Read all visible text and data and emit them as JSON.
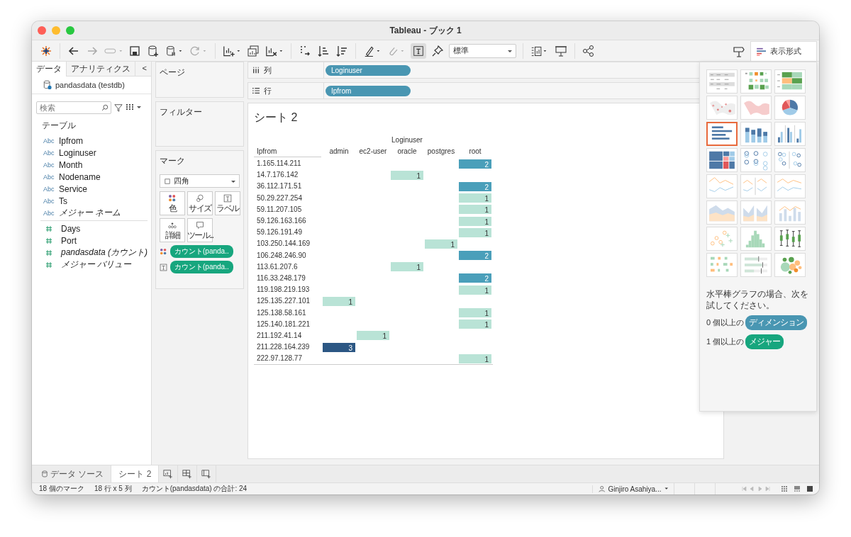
{
  "window": {
    "title": "Tableau - ブック 1"
  },
  "toolbar": {
    "label_toggle_on": true,
    "fit": "標準",
    "show_me_tab": "表示形式"
  },
  "data_pane": {
    "tabs": [
      {
        "label": "データ",
        "selected": true
      },
      {
        "label": "アナリティクス",
        "selected": false
      }
    ],
    "collapse": "<",
    "source": "pandasdata (testdb)",
    "search": {
      "placeholder": "検索"
    },
    "section": "テーブル",
    "fields": [
      {
        "kind": "dimension",
        "type_label": "Abc",
        "name": "Ipfrom",
        "italic": false
      },
      {
        "kind": "dimension",
        "type_label": "Abc",
        "name": "Loginuser",
        "italic": false
      },
      {
        "kind": "dimension",
        "type_label": "Abc",
        "name": "Month",
        "italic": false
      },
      {
        "kind": "dimension",
        "type_label": "Abc",
        "name": "Nodename",
        "italic": false
      },
      {
        "kind": "dimension",
        "type_label": "Abc",
        "name": "Service",
        "italic": false
      },
      {
        "kind": "dimension",
        "type_label": "Abc",
        "name": "Ts",
        "italic": false
      },
      {
        "kind": "dimension",
        "type_label": "Abc",
        "name": "メジャー ネーム",
        "italic": true
      },
      {
        "kind": "measure",
        "name": "Days",
        "italic": false
      },
      {
        "kind": "measure",
        "name": "Port",
        "italic": false
      },
      {
        "kind": "measure",
        "name": "pandasdata (カウント)",
        "italic": true
      },
      {
        "kind": "measure",
        "name": "メジャー バリュー",
        "italic": true
      }
    ]
  },
  "cards": {
    "pages": "ページ",
    "filters": "フィルター",
    "marks": {
      "title": "マーク",
      "mark_type": "四角",
      "buttons": [
        {
          "kind": "color",
          "label": "色"
        },
        {
          "kind": "size",
          "label": "サイズ"
        },
        {
          "kind": "label",
          "label": "ラベル"
        },
        {
          "kind": "detail",
          "label": "詳細"
        },
        {
          "kind": "tooltip",
          "label": "ツール..."
        }
      ],
      "pills": [
        {
          "kind": "color",
          "label": "カウント(panda.."
        },
        {
          "kind": "label",
          "label": "カウント(panda.."
        }
      ]
    }
  },
  "shelves": [
    {
      "kind": "columns",
      "label": "列",
      "pill": "Loginuser"
    },
    {
      "kind": "rows",
      "label": "行",
      "pill": "Ipfrom"
    }
  ],
  "sheet": {
    "title": "シート 2",
    "row_header": "Ipfrom",
    "column_group": "Loginuser",
    "columns": [
      "admin",
      "ec2-user",
      "oracle",
      "postgres",
      "root"
    ],
    "rows": [
      {
        "ip": "1.165.114.211",
        "cells": [
          null,
          null,
          null,
          null,
          {
            "value": "2",
            "color": "#4a9fba"
          }
        ]
      },
      {
        "ip": "14.7.176.142",
        "cells": [
          null,
          null,
          {
            "value": "1",
            "color": "#b9e3d6"
          },
          null,
          null
        ]
      },
      {
        "ip": "36.112.171.51",
        "cells": [
          null,
          null,
          null,
          null,
          {
            "value": "2",
            "color": "#4a9fba"
          }
        ]
      },
      {
        "ip": "50.29.227.254",
        "cells": [
          null,
          null,
          null,
          null,
          {
            "value": "1",
            "color": "#b9e3d6"
          }
        ]
      },
      {
        "ip": "59.11.207.105",
        "cells": [
          null,
          null,
          null,
          null,
          {
            "value": "1",
            "color": "#b9e3d6"
          }
        ]
      },
      {
        "ip": "59.126.163.166",
        "cells": [
          null,
          null,
          null,
          null,
          {
            "value": "1",
            "color": "#b9e3d6"
          }
        ]
      },
      {
        "ip": "59.126.191.49",
        "cells": [
          null,
          null,
          null,
          null,
          {
            "value": "1",
            "color": "#b9e3d6"
          }
        ]
      },
      {
        "ip": "103.250.144.169",
        "cells": [
          null,
          null,
          null,
          {
            "value": "1",
            "color": "#b9e3d6"
          },
          null
        ]
      },
      {
        "ip": "106.248.246.90",
        "cells": [
          null,
          null,
          null,
          null,
          {
            "value": "2",
            "color": "#4a9fba"
          }
        ]
      },
      {
        "ip": "113.61.207.6",
        "cells": [
          null,
          null,
          {
            "value": "1",
            "color": "#b9e3d6"
          },
          null,
          null
        ]
      },
      {
        "ip": "116.33.248.179",
        "cells": [
          null,
          null,
          null,
          null,
          {
            "value": "2",
            "color": "#4a9fba"
          }
        ]
      },
      {
        "ip": "119.198.219.193",
        "cells": [
          null,
          null,
          null,
          null,
          {
            "value": "1",
            "color": "#b9e3d6"
          }
        ]
      },
      {
        "ip": "125.135.227.101",
        "cells": [
          {
            "value": "1",
            "color": "#b9e3d6"
          },
          null,
          null,
          null,
          null
        ]
      },
      {
        "ip": "125.138.58.161",
        "cells": [
          null,
          null,
          null,
          null,
          {
            "value": "1",
            "color": "#b9e3d6"
          }
        ]
      },
      {
        "ip": "125.140.181.221",
        "cells": [
          null,
          null,
          null,
          null,
          {
            "value": "1",
            "color": "#b9e3d6"
          }
        ]
      },
      {
        "ip": "211.192.41.14",
        "cells": [
          null,
          {
            "value": "1",
            "color": "#b9e3d6"
          },
          null,
          null,
          null
        ]
      },
      {
        "ip": "211.228.164.239",
        "cells": [
          {
            "value": "3",
            "color": "#2c5784"
          },
          null,
          null,
          null,
          null
        ]
      },
      {
        "ip": "222.97.128.77",
        "cells": [
          null,
          null,
          null,
          null,
          {
            "value": "1",
            "color": "#b9e3d6"
          }
        ]
      }
    ]
  },
  "show_me": {
    "charts": [
      {
        "kind": "text-table",
        "selected": false
      },
      {
        "kind": "heat-map",
        "selected": false
      },
      {
        "kind": "highlight-table",
        "selected": false
      },
      {
        "kind": "symbol-map",
        "selected": false
      },
      {
        "kind": "filled-map",
        "selected": false
      },
      {
        "kind": "pie",
        "selected": false
      },
      {
        "kind": "horizontal-bars",
        "selected": true
      },
      {
        "kind": "stacked-bars",
        "selected": false
      },
      {
        "kind": "side-by-side-bars",
        "selected": false
      },
      {
        "kind": "treemap",
        "selected": false
      },
      {
        "kind": "circle-views",
        "selected": false
      },
      {
        "kind": "side-by-side-circles",
        "selected": false
      },
      {
        "kind": "lines",
        "selected": false
      },
      {
        "kind": "lines-panes",
        "selected": false
      },
      {
        "kind": "dual-lines",
        "selected": false
      },
      {
        "kind": "area",
        "selected": false
      },
      {
        "kind": "area-panes",
        "selected": false
      },
      {
        "kind": "dual-combination",
        "selected": false
      },
      {
        "kind": "scatter",
        "selected": false
      },
      {
        "kind": "histogram",
        "selected": false
      },
      {
        "kind": "box-whisker",
        "selected": false
      },
      {
        "kind": "gantt",
        "selected": false
      },
      {
        "kind": "bullet",
        "selected": false
      },
      {
        "kind": "packed-bubbles",
        "selected": false
      }
    ],
    "hint": "水平棒グラフの場合、次を試してください。",
    "requirements": [
      {
        "kind": "dimension",
        "prefix": "0 個以上の",
        "pill": "ディメンション"
      },
      {
        "kind": "measure",
        "prefix": "1 個以上の",
        "pill": "メジャー"
      }
    ]
  },
  "sheet_tabs": [
    {
      "kind": "data-source",
      "label": "データ ソース",
      "selected": false
    },
    {
      "kind": "sheet",
      "label": "シート 2",
      "selected": true
    }
  ],
  "status_bar": {
    "items": [
      "18 個のマーク",
      "18 行 x 5 列",
      "カウント(pandasdata) の合計: 24"
    ],
    "user": "Ginjiro Asahiya..."
  }
}
